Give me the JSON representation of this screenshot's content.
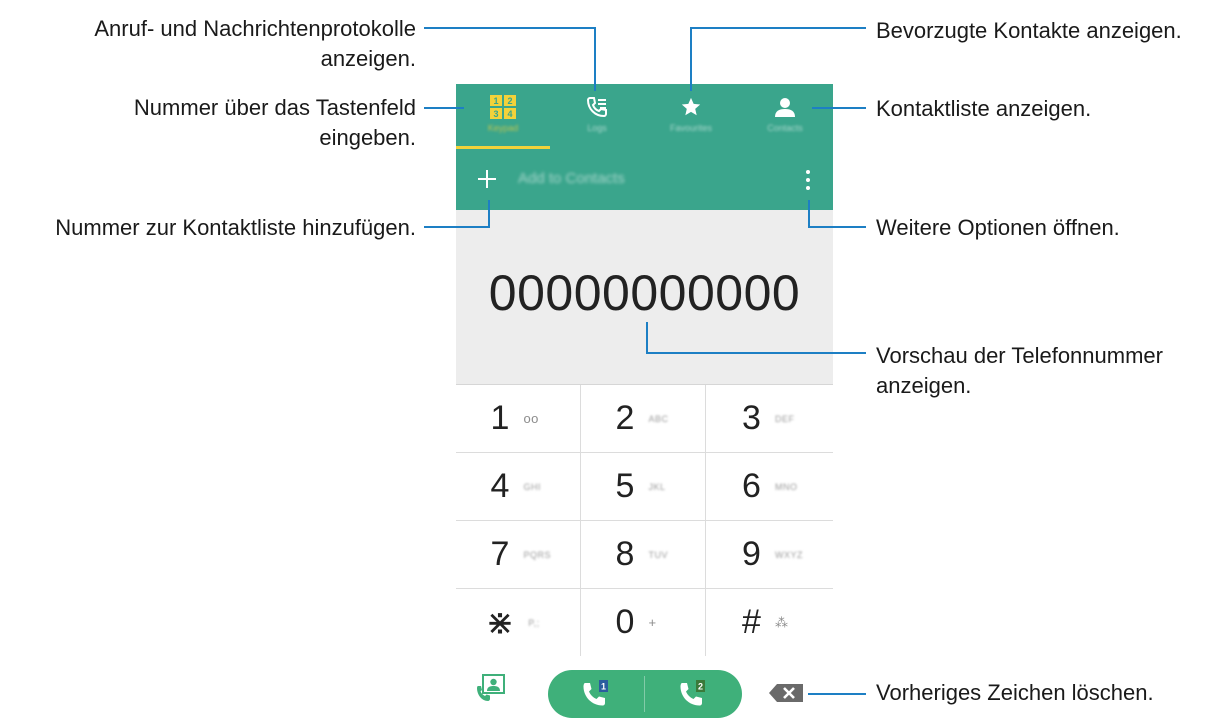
{
  "annotations": {
    "logs": [
      "Anruf- und Nachrichtenprotokolle",
      "anzeigen."
    ],
    "keypad": [
      "Nummer über das Tastenfeld",
      "eingeben."
    ],
    "add_contact": "Nummer zur Kontaktliste hinzufügen.",
    "favourites": "Bevorzugte Kontakte anzeigen.",
    "contacts": "Kontaktliste anzeigen.",
    "more_options": "Weitere Optionen öffnen.",
    "preview": [
      "Vorschau der Telefonnummer",
      "anzeigen."
    ],
    "delete": "Vorheriges Zeichen löschen."
  },
  "tabs": [
    {
      "label": "Keypad",
      "icon": "keypad-icon",
      "selected": true
    },
    {
      "label": "Logs",
      "icon": "call-log-icon",
      "selected": false
    },
    {
      "label": "Favourites",
      "icon": "star-icon",
      "selected": false
    },
    {
      "label": "Contacts",
      "icon": "person-icon",
      "selected": false
    }
  ],
  "actionbar": {
    "add_label": "Add to Contacts",
    "add_icon": "plus-icon",
    "more_icon": "more-vertical-icon"
  },
  "display_number": "00000000000",
  "keys": [
    {
      "digit": "1",
      "letters": "oo",
      "letters_clear": true
    },
    {
      "digit": "2",
      "letters": "ABC"
    },
    {
      "digit": "3",
      "letters": "DEF"
    },
    {
      "digit": "4",
      "letters": "GHI"
    },
    {
      "digit": "5",
      "letters": "JKL"
    },
    {
      "digit": "6",
      "letters": "MNO"
    },
    {
      "digit": "7",
      "letters": "PQRS"
    },
    {
      "digit": "8",
      "letters": "TUV"
    },
    {
      "digit": "9",
      "letters": "WXYZ"
    },
    {
      "digit": "⋇",
      "letters": "P,;"
    },
    {
      "digit": "0",
      "letters": "+",
      "letters_clear": true
    },
    {
      "digit": "#",
      "letters": "⁂"
    }
  ],
  "bottombar": {
    "sim1_badge": "1",
    "sim2_badge": "2"
  },
  "colors": {
    "header": "#3aa58c",
    "tab_indicator": "#f2d23a",
    "call_button": "#3fb07a",
    "leader_line": "#1d7fc4"
  }
}
